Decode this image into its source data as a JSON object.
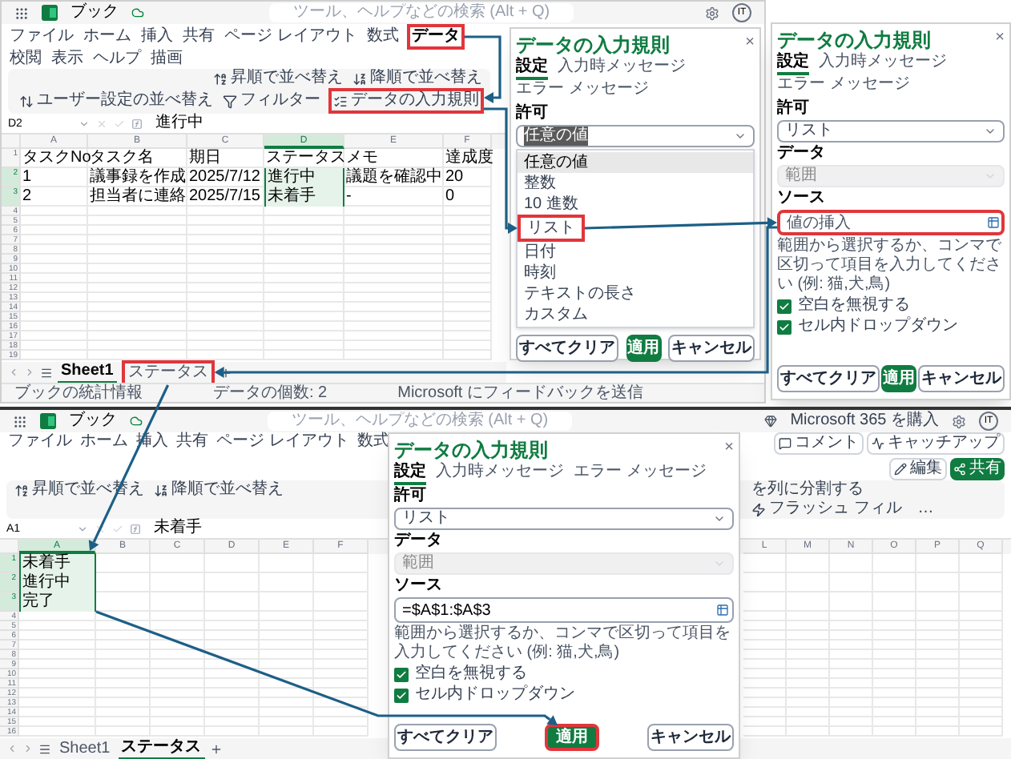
{
  "top_window": {
    "app_bar": {
      "title": "ブック",
      "search_placeholder": "ツール、ヘルプなどの検索 (Alt + Q)",
      "avatar": "IT"
    },
    "menu_tabs": [
      {
        "label": "ファイル",
        "selected": false,
        "highlighted": false
      },
      {
        "label": "ホーム",
        "selected": false,
        "highlighted": false
      },
      {
        "label": "挿入",
        "selected": false,
        "highlighted": false
      },
      {
        "label": "共有",
        "selected": false,
        "highlighted": false
      },
      {
        "label": "ページ レイアウト",
        "selected": false,
        "highlighted": false
      },
      {
        "label": "数式",
        "selected": false,
        "highlighted": false
      },
      {
        "label": "データ",
        "selected": true,
        "highlighted": true
      },
      {
        "label": "校閲",
        "selected": false,
        "highlighted": false
      },
      {
        "label": "表示",
        "selected": false,
        "highlighted": false
      },
      {
        "label": "ヘルプ",
        "selected": false,
        "highlighted": false
      },
      {
        "label": "描画",
        "selected": false,
        "highlighted": false
      }
    ],
    "ribbon": [
      {
        "label": "昇順で並べ替え",
        "kind": "sort-ascending",
        "highlighted": false
      },
      {
        "label": "降順で並べ替え",
        "kind": "sort-descending",
        "highlighted": false
      },
      {
        "label": "ユーザー設定の並べ替え",
        "kind": "custom-sort",
        "highlighted": false
      },
      {
        "label": "フィルター",
        "kind": "filter",
        "highlighted": false
      },
      {
        "label": "データの入力規則",
        "kind": "data-validation",
        "highlighted": true
      }
    ],
    "formula_bar": {
      "name_box": "D2",
      "value": "進行中"
    },
    "columns": [
      {
        "label": "A",
        "selected": false
      },
      {
        "label": "B",
        "selected": false
      },
      {
        "label": "C",
        "selected": false
      },
      {
        "label": "D",
        "selected": true
      },
      {
        "label": "E",
        "selected": false
      },
      {
        "label": "F",
        "selected": false
      }
    ],
    "rows": [
      {
        "header": "1",
        "selected": false,
        "cells": [
          "タスクNo",
          "タスク名",
          "期日",
          "ステータス",
          "メモ",
          "達成度"
        ]
      },
      {
        "header": "2",
        "selected": true,
        "cells": [
          "1",
          "議事録を作成",
          "2025/7/12",
          "進行中",
          "議題を確認中",
          "20"
        ]
      },
      {
        "header": "3",
        "selected": true,
        "cells": [
          "2",
          "担当者に連絡",
          "2025/7/15",
          "未着手",
          "-",
          "0"
        ]
      },
      {
        "header": "4",
        "selected": false
      },
      {
        "header": "5",
        "selected": false
      },
      {
        "header": "6",
        "selected": false
      },
      {
        "header": "7",
        "selected": false
      },
      {
        "header": "8",
        "selected": false
      },
      {
        "header": "9",
        "selected": false
      },
      {
        "header": "10",
        "selected": false
      },
      {
        "header": "11",
        "selected": false
      },
      {
        "header": "12",
        "selected": false
      },
      {
        "header": "13",
        "selected": false
      },
      {
        "header": "14",
        "selected": false
      },
      {
        "header": "15",
        "selected": false
      },
      {
        "header": "16",
        "selected": false
      },
      {
        "header": "17",
        "selected": false
      },
      {
        "header": "18",
        "selected": false
      },
      {
        "header": "19",
        "selected": false
      }
    ],
    "sheet_tabs": [
      {
        "label": "Sheet1",
        "selected": true,
        "highlighted": false
      },
      {
        "label": "ステータス",
        "selected": false,
        "highlighted": true
      }
    ],
    "status_bar": [
      "ブックの統計情報",
      "データの個数: 2",
      "Microsoft にフィードバックを送信"
    ]
  },
  "dialog_allow": {
    "title": "データの入力規則",
    "close": "×",
    "tabs": [
      {
        "label": "設定",
        "selected": true
      },
      {
        "label": "入力時メッセージ",
        "selected": false
      },
      {
        "label": "エラー メッセージ",
        "selected": false
      }
    ],
    "allow": {
      "label": "許可",
      "value": "任意の値",
      "expanded": true,
      "options": [
        {
          "label": "任意の値",
          "selected": true,
          "highlighted": false
        },
        {
          "label": "整数",
          "selected": false,
          "highlighted": false
        },
        {
          "label": "10 進数",
          "selected": false,
          "highlighted": false
        },
        {
          "label": "リスト",
          "selected": false,
          "highlighted": true
        },
        {
          "label": "日付",
          "selected": false,
          "highlighted": false
        },
        {
          "label": "時刻",
          "selected": false,
          "highlighted": false
        },
        {
          "label": "テキストの長さ",
          "selected": false,
          "highlighted": false
        },
        {
          "label": "カスタム",
          "selected": false,
          "highlighted": false
        }
      ]
    },
    "buttons": [
      {
        "label": "すべてクリア",
        "kind": "secondary",
        "highlighted": false
      },
      {
        "label": "適用",
        "kind": "primary",
        "highlighted": false
      },
      {
        "label": "キャンセル",
        "kind": "secondary",
        "highlighted": false
      }
    ]
  },
  "dialog_source": {
    "title": "データの入力規則",
    "close": "×",
    "tabs": [
      {
        "label": "設定",
        "selected": true
      },
      {
        "label": "入力時メッセージ",
        "selected": false
      },
      {
        "label": "エラー メッセージ",
        "selected": false
      }
    ],
    "allow": {
      "label": "許可",
      "value": "リスト",
      "expanded": false
    },
    "data": {
      "label": "データ",
      "value": "範囲",
      "disabled": true
    },
    "source": {
      "label": "ソース",
      "placeholder": "値の挿入",
      "highlighted": true
    },
    "hint": "範囲から選択するか、コンマで区切って項目を入力してください (例: 猫,犬,鳥)",
    "options": [
      {
        "label": "空白を無視する",
        "checked": true
      },
      {
        "label": "セル内ドロップダウン",
        "checked": true
      }
    ],
    "buttons": [
      {
        "label": "すべてクリア",
        "kind": "secondary",
        "highlighted": false
      },
      {
        "label": "適用",
        "kind": "primary",
        "highlighted": false
      },
      {
        "label": "キャンセル",
        "kind": "secondary",
        "highlighted": false
      }
    ]
  },
  "bottom_window": {
    "app_bar": {
      "title": "ブック",
      "search_placeholder": "ツール、ヘルプなどの検索 (Alt + Q)",
      "promo": "Microsoft 365 を購入",
      "avatar": "IT"
    },
    "menu_tabs": [
      {
        "label": "ファイル",
        "selected": false,
        "highlighted": false
      },
      {
        "label": "ホーム",
        "selected": false,
        "highlighted": false
      },
      {
        "label": "挿入",
        "selected": false,
        "highlighted": false
      },
      {
        "label": "共有",
        "selected": false,
        "highlighted": false
      },
      {
        "label": "ページ レイアウト",
        "selected": false,
        "highlighted": false
      },
      {
        "label": "数式",
        "selected": false,
        "highlighted": false
      }
    ],
    "actions": [
      {
        "label": "コメント",
        "kind": "comment"
      },
      {
        "label": "キャッチアップ",
        "kind": "catch-up"
      },
      {
        "label": "編集",
        "kind": "edit"
      },
      {
        "label": "共有",
        "kind": "share"
      }
    ],
    "ribbon_left": [
      {
        "label": "昇順で並べ替え",
        "kind": "sort-ascending",
        "highlighted": false
      },
      {
        "label": "降順で並べ替え",
        "kind": "sort-descending",
        "highlighted": false
      }
    ],
    "ribbon_right": [
      {
        "label": "を列に分割する",
        "kind": "text",
        "highlighted": false
      },
      {
        "label": "フラッシュ フィル",
        "kind": "flash-fill",
        "highlighted": false
      },
      {
        "label": "…",
        "kind": "text",
        "highlighted": false
      }
    ],
    "formula_bar": {
      "name_box": "A1",
      "value": "未着手"
    },
    "columns_left": [
      {
        "label": "A",
        "selected": true
      },
      {
        "label": "B",
        "selected": false
      },
      {
        "label": "C",
        "selected": false
      },
      {
        "label": "D",
        "selected": false
      },
      {
        "label": "E",
        "selected": false
      },
      {
        "label": "F",
        "selected": false
      }
    ],
    "columns_right": [
      {
        "label": "L",
        "selected": false
      },
      {
        "label": "M",
        "selected": false
      },
      {
        "label": "N",
        "selected": false
      },
      {
        "label": "O",
        "selected": false
      },
      {
        "label": "P",
        "selected": false
      },
      {
        "label": "Q",
        "selected": false
      }
    ],
    "rows": [
      {
        "header": "1",
        "selected": true,
        "cells": [
          "未着手"
        ]
      },
      {
        "header": "2",
        "selected": true,
        "cells": [
          "進行中"
        ]
      },
      {
        "header": "3",
        "selected": true,
        "cells": [
          "完了"
        ]
      },
      {
        "header": "4",
        "selected": false
      },
      {
        "header": "5",
        "selected": false
      },
      {
        "header": "6",
        "selected": false
      },
      {
        "header": "7",
        "selected": false
      },
      {
        "header": "8",
        "selected": false
      },
      {
        "header": "9",
        "selected": false
      },
      {
        "header": "10",
        "selected": false
      },
      {
        "header": "11",
        "selected": false
      },
      {
        "header": "12",
        "selected": false
      },
      {
        "header": "13",
        "selected": false
      },
      {
        "header": "14",
        "selected": false
      },
      {
        "header": "15",
        "selected": false
      },
      {
        "header": "16",
        "selected": false
      }
    ],
    "sheet_tabs": [
      {
        "label": "Sheet1",
        "selected": false,
        "highlighted": false
      },
      {
        "label": "ステータス",
        "selected": true,
        "highlighted": false
      }
    ]
  },
  "dialog_apply": {
    "title": "データの入力規則",
    "close": "×",
    "tabs": [
      {
        "label": "設定",
        "selected": true
      },
      {
        "label": "入力時メッセージ",
        "selected": false
      },
      {
        "label": "エラー メッセージ",
        "selected": false
      }
    ],
    "allow": {
      "label": "許可",
      "value": "リスト",
      "expanded": false
    },
    "data": {
      "label": "データ",
      "value": "範囲",
      "disabled": true
    },
    "source": {
      "label": "ソース",
      "value": "=$A$1:$A$3",
      "highlighted": false
    },
    "hint": "範囲から選択するか、コンマで区切って項目を入力してください (例: 猫,犬,鳥)",
    "options": [
      {
        "label": "空白を無視する",
        "checked": true
      },
      {
        "label": "セル内ドロップダウン",
        "checked": true
      }
    ],
    "buttons": [
      {
        "label": "すべてクリア",
        "kind": "secondary",
        "highlighted": false
      },
      {
        "label": "適用",
        "kind": "primary",
        "highlighted": true
      },
      {
        "label": "キャンセル",
        "kind": "secondary",
        "highlighted": false
      }
    ]
  }
}
